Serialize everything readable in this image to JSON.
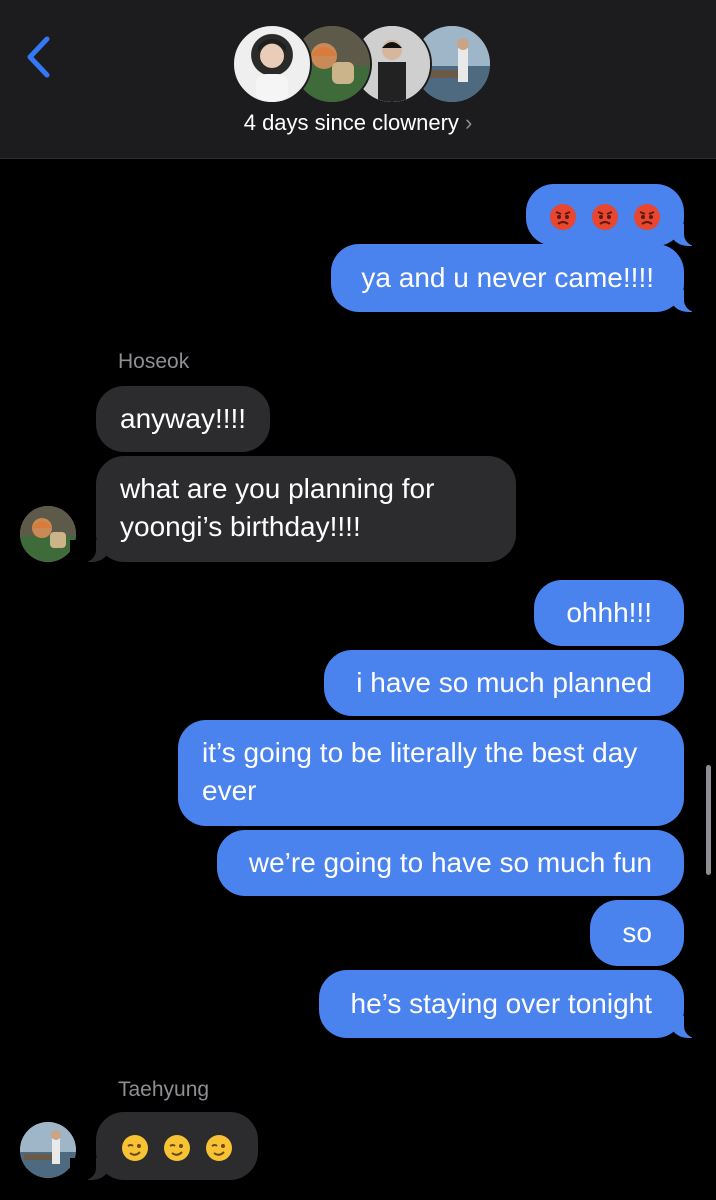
{
  "header": {
    "group_name": "4 days since clownery",
    "chevron": "›",
    "back_icon": "chevron-left-icon"
  },
  "messages": {
    "angry_emojis": "😡😡😡",
    "ya_never_came": "ya and u never came!!!!",
    "sender_hoseok": "Hoseok",
    "anyway": "anyway!!!!",
    "planning": "what are you planning for yoongi’s birthday!!!!",
    "ohhh": "ohhh!!!",
    "so_much_planned": "i have so much planned",
    "best_day": "it’s going to be literally the best day ever",
    "so_much_fun": "we’re going to have so much fun",
    "so": "so",
    "staying_over": "he’s staying over tonight",
    "sender_taehyung": "Taehyung",
    "winks": "😉😉😉"
  },
  "colors": {
    "outgoing": "#4a82ee",
    "incoming": "#2c2c2e",
    "header_bg": "#1c1c1e",
    "accent": "#3478f6"
  }
}
